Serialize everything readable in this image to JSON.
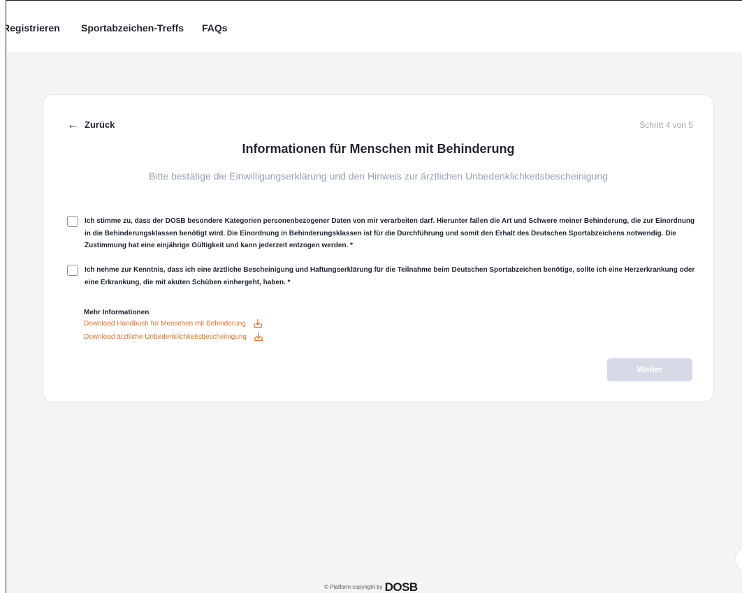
{
  "nav": {
    "items": [
      {
        "label": "Registrieren"
      },
      {
        "label": "Sportabzeichen-Treffs"
      },
      {
        "label": "FAQs"
      }
    ]
  },
  "header": {
    "back_label": "Zurück",
    "back_icon": "arrow-left-icon",
    "step_label": "Schritt 4 von 5"
  },
  "main": {
    "title": "Informationen für Menschen mit Behinderung",
    "subtitle": "Bitte bestätige die Einwilligungserklärung und den Hinweis zur ärztlichen Unbedenklichkeitsbescheinigung",
    "consents": [
      {
        "checked": false,
        "text": "Ich stimme zu, dass der DOSB besondere Kategorien personenbezogener Daten von mir verarbeiten darf. Hierunter fallen die Art und Schwere meiner Behinderung, die zur Einordnung in die Behinderungsklassen benötigt wird. Die Einordnung in Behinderungsklassen ist für die Durchführung und somit den Erhalt des Deutschen Sportabzeichens notwendig. Die Zustimmung hat eine einjährige Gültigkeit und kann jederzeit entzogen werden. *"
      },
      {
        "checked": false,
        "text": "Ich nehme zur Kenntnis, dass ich eine ärztliche Bescheinigung und Haftungserklärung für die Teilnahme beim Deutschen Sportabzeichen benötige, sollte ich eine Herzerkrankung oder eine Erkrankung, die mit akuten Schüben einhergeht, haben. *"
      }
    ],
    "more_info_label": "Mehr Informationen",
    "downloads": [
      {
        "label": "Download Handbuch für Menschen mit Behinderung",
        "icon": "download-icon"
      },
      {
        "label": "Download ärztliche Unbedenklichkeitsbescheinigung",
        "icon": "download-icon"
      }
    ],
    "next_label": "Weiter"
  },
  "footer": {
    "copyright": "© Platform copyright by",
    "logo_text": "DOSB"
  },
  "colors": {
    "accent": "#e8722c",
    "disabled_button": "#d6dae6",
    "background": "#f4f4f5",
    "subtitle": "#9aa0b4"
  }
}
